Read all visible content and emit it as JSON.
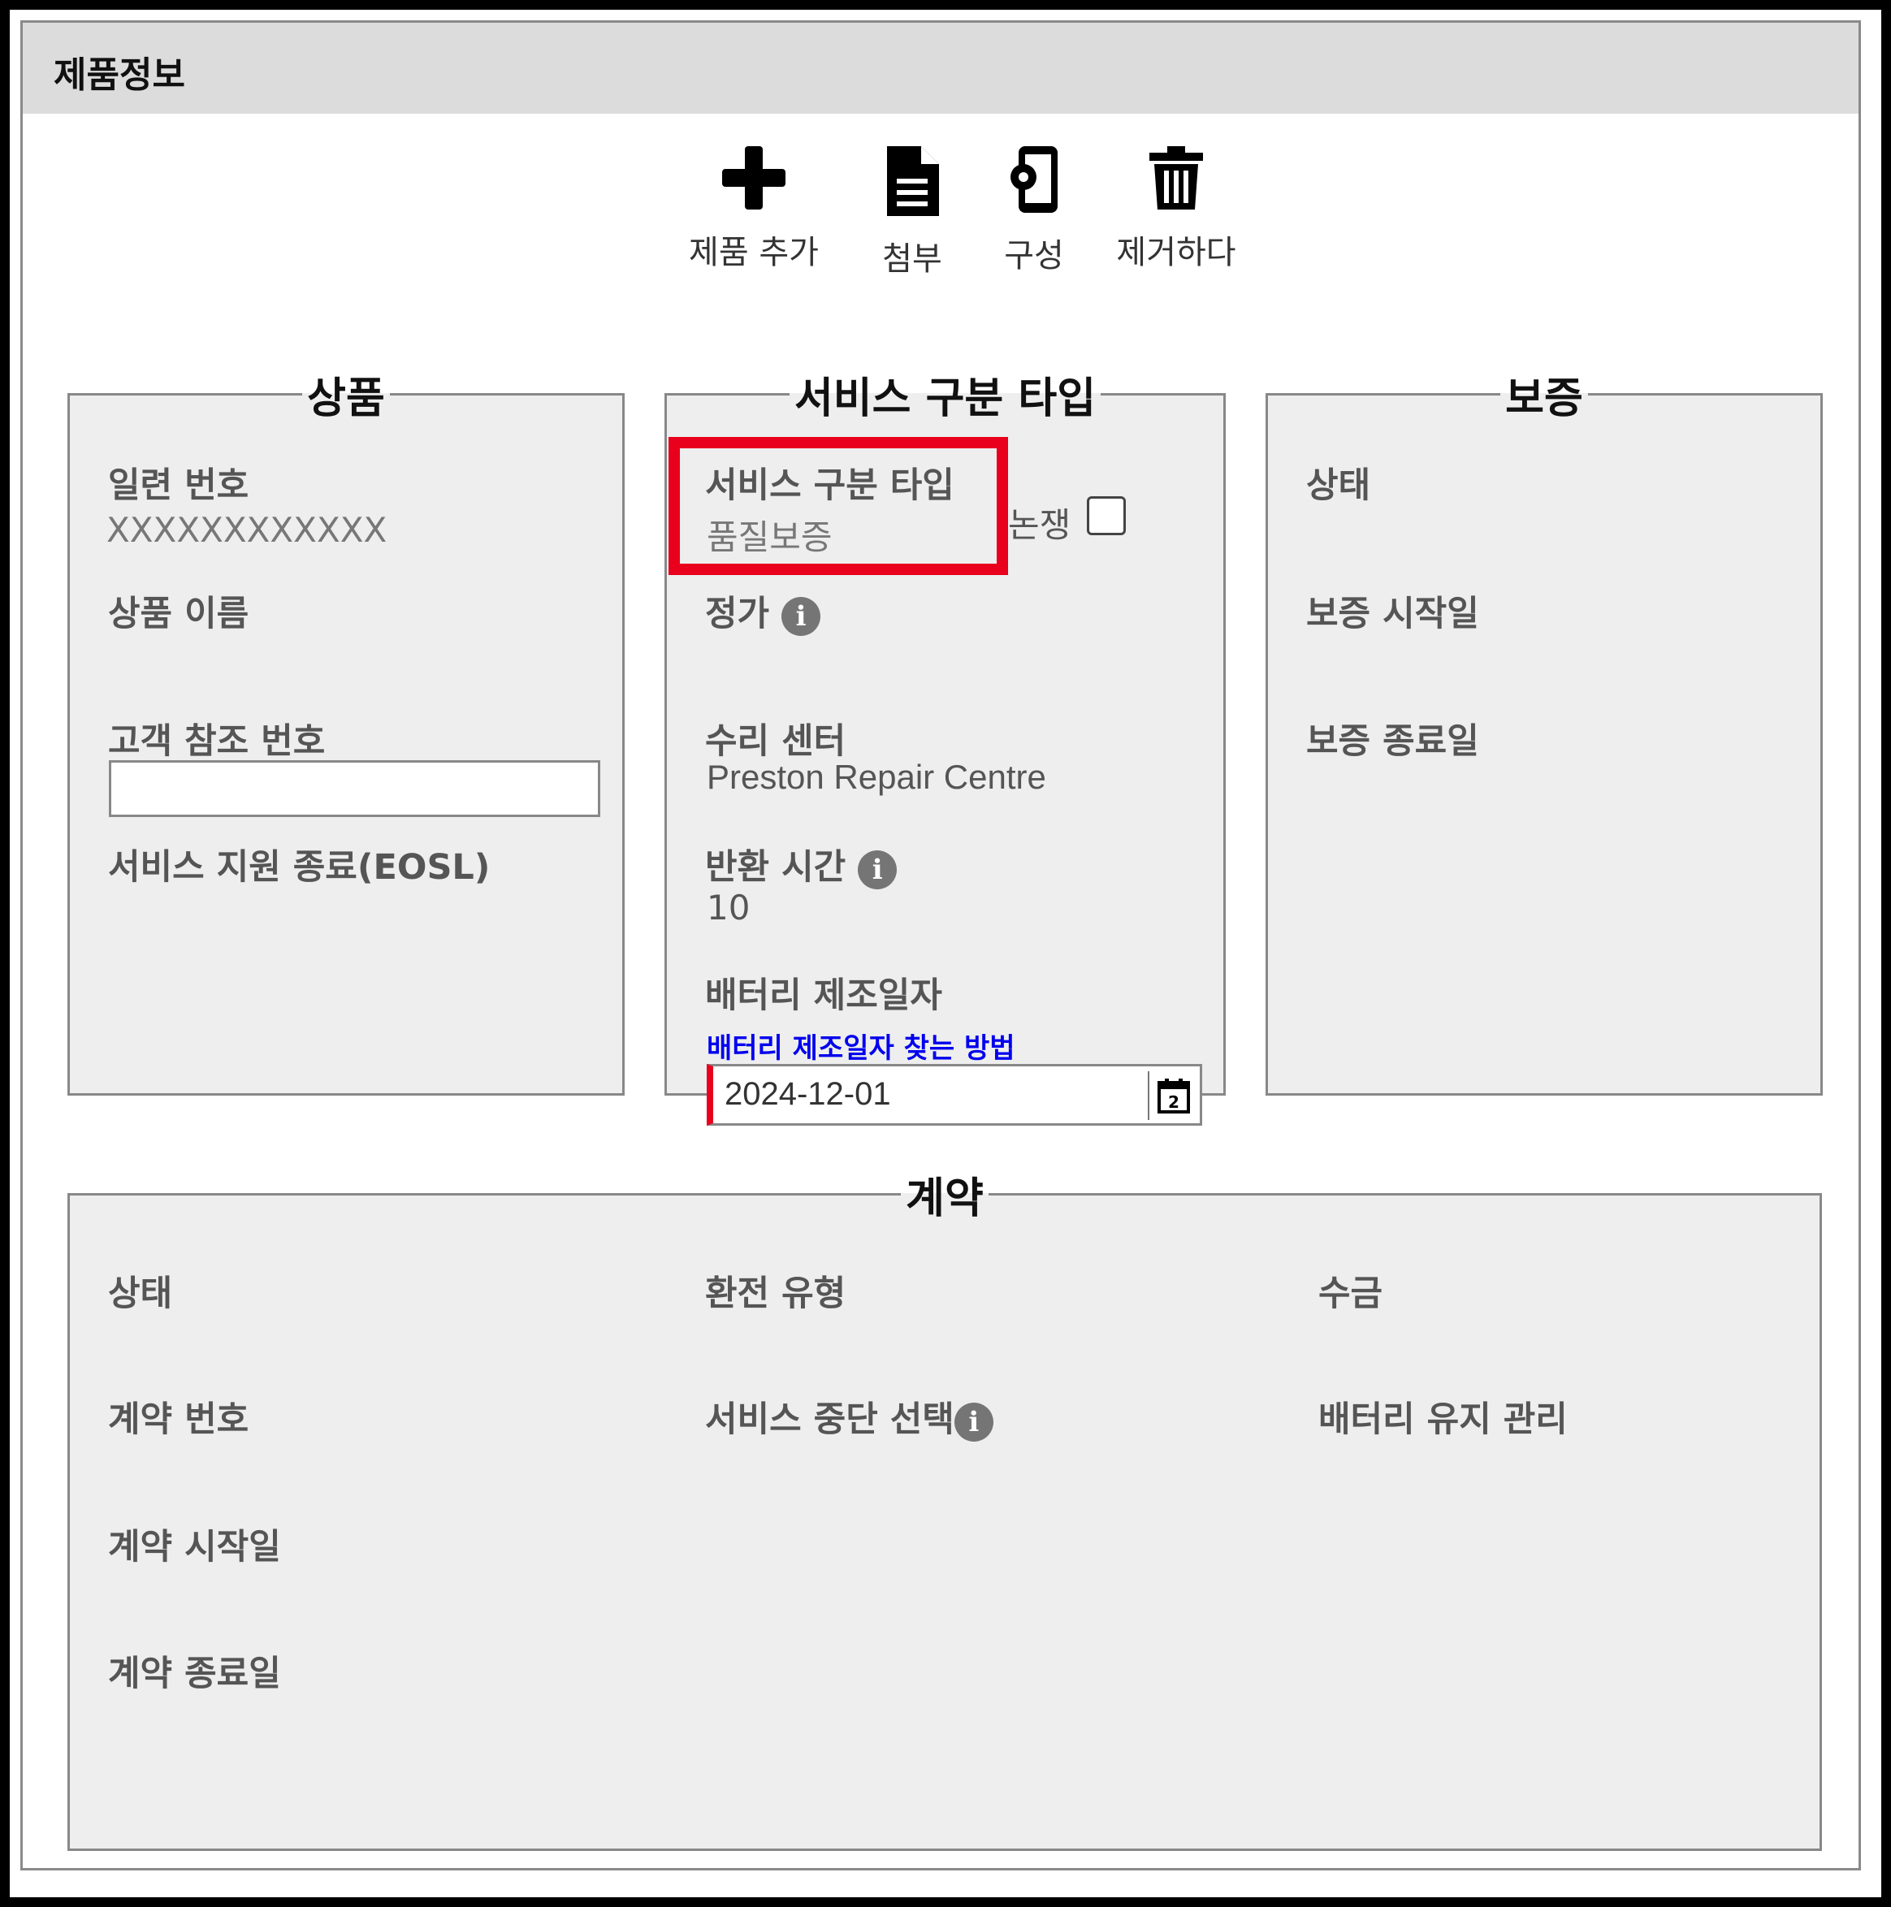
{
  "panel": {
    "title": "제품정보"
  },
  "toolbar": {
    "add": "제품 추가",
    "attach": "첨부",
    "configure": "구성",
    "remove": "제거하다"
  },
  "product": {
    "legend": "상품",
    "serial_label": "일련 번호",
    "serial_value": "XXXXXXXXXXXX",
    "name_label": "상품 이름",
    "customer_ref_label": "고객 참조 번호",
    "customer_ref_value": "",
    "eosl_label": "서비스 지원 종료(EOSL)"
  },
  "service": {
    "legend": "서비스 구분 타입",
    "type_label": "서비스 구분 타입",
    "type_value": "품질보증",
    "dispute_label": "논쟁",
    "dispute_checked": false,
    "price_label": "정가",
    "repair_center_label": "수리 센터",
    "repair_center_value": "Preston Repair Centre",
    "turnaround_label": "반환 시간",
    "turnaround_value": "10",
    "battery_date_label": "배터리 제조일자",
    "battery_date_link": "배터리 제조일자 찾는 방법",
    "battery_date_value": "2024-12-01"
  },
  "warranty": {
    "legend": "보증",
    "status_label": "상태",
    "start_label": "보증 시작일",
    "end_label": "보증 종료일"
  },
  "contract": {
    "legend": "계약",
    "status_label": "상태",
    "number_label": "계약 번호",
    "start_label": "계약 시작일",
    "end_label": "계약 종료일",
    "refund_label": "환전 유형",
    "service_stop_label": "서비스 중단 선택",
    "billing_label": "수금",
    "battery_maint_label": "배터리 유지 관리"
  },
  "icons": {
    "info": "info-icon",
    "calendar": "calendar-icon"
  },
  "colors": {
    "highlight": "#e8001c",
    "link": "#0000ee",
    "required_bar": "#e8001c"
  }
}
